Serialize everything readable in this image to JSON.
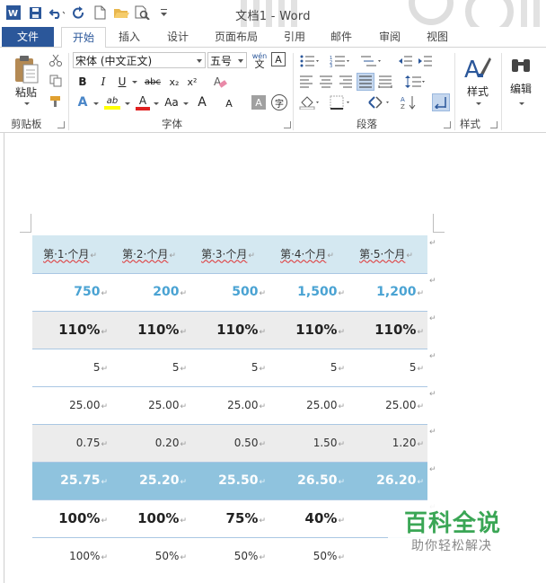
{
  "window": {
    "title": "文档1 - Word",
    "app_icon": "word-icon"
  },
  "qat": {
    "icons": [
      "word-icon",
      "save-icon",
      "undo-icon",
      "redo-icon",
      "new-doc-icon",
      "open-folder-icon",
      "print-preview-icon",
      "customize-qat-icon"
    ]
  },
  "tabs": {
    "file": "文件",
    "home": "开始",
    "insert": "插入",
    "design": "设计",
    "layout": "页面布局",
    "references": "引用",
    "mailings": "邮件",
    "review": "审阅",
    "view": "视图",
    "active": "开始"
  },
  "ribbon": {
    "clipboard": {
      "label": "剪贴板",
      "paste": "粘贴"
    },
    "font": {
      "label": "字体",
      "font_name": "宋体 (中文正文)",
      "font_size": "五号",
      "phonetic_top": "wén",
      "phonetic_bottom": "文",
      "border_char": "A",
      "bold": "B",
      "italic": "I",
      "underline": "U",
      "strike": "abc",
      "sub": "x₂",
      "sup": "x²",
      "effects": "A",
      "highlight": "ab",
      "font_color": "A",
      "case": "Aa",
      "grow": "A",
      "shrink": "A",
      "shade": "A",
      "enclose": "字"
    },
    "paragraph": {
      "label": "段落"
    },
    "styles": {
      "label": "样式",
      "button": "样式"
    },
    "editing": {
      "button": "编辑"
    }
  },
  "colors": {
    "word_blue": "#2b579a",
    "header_fill": "#d4e8f1",
    "blue_text": "#4aa3d3",
    "total_fill": "#8fc3de",
    "gray_fill": "#ececec",
    "watermark_green": "#3aa655"
  },
  "table": {
    "header": [
      "第·1·个月",
      "第·2·个月",
      "第·3·个月",
      "第·4·个月",
      "第·5·个月"
    ],
    "rows": [
      [
        "750",
        "200",
        "500",
        "1,500",
        "1,200"
      ],
      [
        "110%",
        "110%",
        "110%",
        "110%",
        "110%"
      ],
      [
        "5",
        "5",
        "5",
        "5",
        "5"
      ],
      [
        "25.00",
        "25.00",
        "25.00",
        "25.00",
        "25.00"
      ],
      [
        "0.75",
        "0.20",
        "0.50",
        "1.50",
        "1.20"
      ],
      [
        "25.75",
        "25.20",
        "25.50",
        "26.50",
        "26.20"
      ],
      [
        "100%",
        "100%",
        "75%",
        "40%",
        ""
      ],
      [
        "100%",
        "50%",
        "50%",
        "50%",
        ""
      ]
    ],
    "cell_mark": "↵"
  },
  "watermark": {
    "main": "百科全说",
    "sub": "助你轻松解决"
  }
}
